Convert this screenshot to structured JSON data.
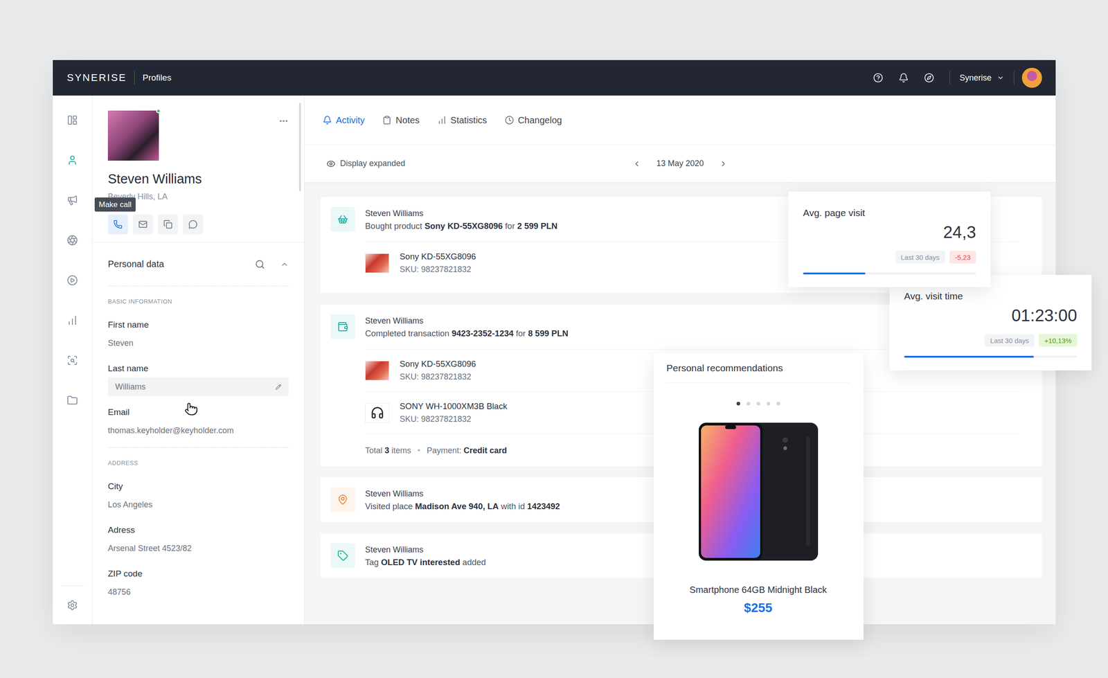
{
  "topbar": {
    "logo": "SYNERISE",
    "app": "Profiles",
    "workspace": "Synerise"
  },
  "rail": {
    "items": [
      {
        "selected": false
      },
      {
        "selected": true
      },
      {
        "selected": false
      },
      {
        "selected": false
      },
      {
        "selected": false
      },
      {
        "selected": false
      },
      {
        "selected": false
      },
      {
        "selected": false
      }
    ]
  },
  "profile": {
    "name": "Steven Williams",
    "location": "Beverly Hills, LA",
    "online": true,
    "tooltip": "Make call",
    "actions": [
      {
        "selected": true
      },
      {
        "selected": false
      },
      {
        "selected": false
      },
      {
        "selected": false
      }
    ]
  },
  "personal_data": {
    "title": "Personal data",
    "expanded": true,
    "sections": [
      {
        "title": "BASIC INFORMATION",
        "fields": [
          {
            "label": "First name",
            "value": "Steven",
            "editing": false
          },
          {
            "label": "Last name",
            "value": "Williams",
            "editing": true
          },
          {
            "label": "Email",
            "value": "thomas.keyholder@keyholder.com",
            "editing": false
          }
        ]
      },
      {
        "title": "ADDRESS",
        "fields": [
          {
            "label": "City",
            "value": "Los Angeles",
            "editing": false
          },
          {
            "label": "Adress",
            "value": "Arsenal Street 4523/82",
            "editing": false
          },
          {
            "label": "ZIP code",
            "value": "48756",
            "editing": false
          }
        ]
      }
    ]
  },
  "tabs": [
    {
      "label": "Activity",
      "selected": true
    },
    {
      "label": "Notes",
      "selected": false
    },
    {
      "label": "Statistics",
      "selected": false
    },
    {
      "label": "Changelog",
      "selected": false
    }
  ],
  "toolbar": {
    "display": "Display expanded",
    "date": "13 May 2020"
  },
  "events": [
    {
      "kind": "purchase",
      "color": "#1bb3a3",
      "actor": "Steven Williams",
      "description": [
        {
          "text": "Bought product ",
          "bold": false
        },
        {
          "text": "Sony KD-55XG8096",
          "bold": true
        },
        {
          "text": " for ",
          "bold": false
        },
        {
          "text": "2 599 PLN",
          "bold": true
        }
      ],
      "items": [
        {
          "kind": "tv",
          "name": "Sony KD-55XG8096",
          "sku": "SKU: 98237821832"
        }
      ]
    },
    {
      "kind": "transaction",
      "color": "#1bb3a3",
      "actor": "Steven Williams",
      "description": [
        {
          "text": "Completed transaction ",
          "bold": false
        },
        {
          "text": "9423-2352-1234",
          "bold": true
        },
        {
          "text": " for ",
          "bold": false
        },
        {
          "text": "8 599 PLN",
          "bold": true
        }
      ],
      "items": [
        {
          "kind": "tv",
          "name": "Sony KD-55XG8096",
          "sku": "SKU: 98237821832"
        },
        {
          "kind": "headphones",
          "name": "SONY WH-1000XM3B Black",
          "sku": "SKU: 98237821832"
        }
      ],
      "summary": {
        "left": [
          {
            "text": "Total ",
            "bold": false
          },
          {
            "text": "3",
            "bold": true
          },
          {
            "text": " items",
            "bold": false
          }
        ],
        "separator": "•",
        "right": [
          {
            "text": "Payment: ",
            "bold": false
          },
          {
            "text": "Credit card",
            "bold": true
          }
        ]
      }
    },
    {
      "kind": "visit",
      "color": "#f0883e",
      "actor": "Steven Williams",
      "description": [
        {
          "text": "Visited place ",
          "bold": false
        },
        {
          "text": "Madison Ave 940, LA",
          "bold": true
        },
        {
          "text": " with id ",
          "bold": false
        },
        {
          "text": "1423492",
          "bold": true
        }
      ]
    },
    {
      "kind": "tag",
      "color": "#1bb3a3",
      "actor": "Steven Williams",
      "description": [
        {
          "text": "Tag ",
          "bold": false
        },
        {
          "text": "OLED TV interested",
          "bold": true
        },
        {
          "text": " added",
          "bold": false
        }
      ]
    }
  ],
  "metrics": [
    {
      "title": "Avg. page visit",
      "value": "24,3",
      "period": "Last 30 days",
      "change": "-5,23",
      "trend": "down",
      "level": 0.36
    },
    {
      "title": "Avg. visit time",
      "value": "01:23:00",
      "period": "Last 30 days",
      "change": "+10,13%",
      "trend": "up",
      "level": 0.75
    }
  ],
  "recommendations": {
    "title": "Personal recommendations",
    "dots": [
      {
        "selected": true
      },
      {
        "selected": false
      },
      {
        "selected": false
      },
      {
        "selected": false
      },
      {
        "selected": false
      }
    ],
    "product": {
      "name": "Smartphone 64GB Midnight Black",
      "price": "$255"
    }
  }
}
